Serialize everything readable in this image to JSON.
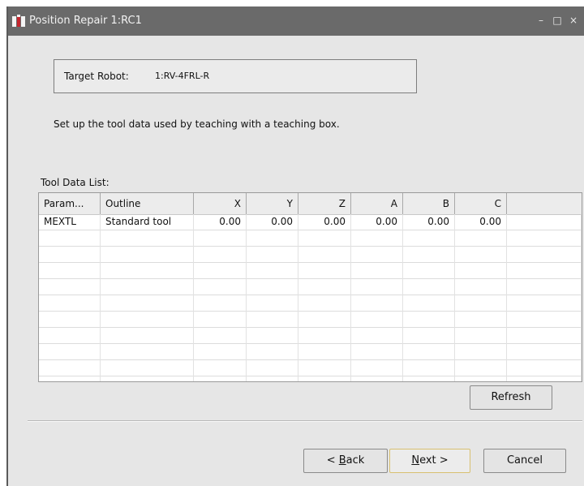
{
  "window": {
    "title": "Position Repair 1:RC1",
    "minimize": "–",
    "maximize": "□",
    "close": "×"
  },
  "target": {
    "label": "Target Robot:",
    "value": "1:RV-4FRL-R"
  },
  "description": "Set up the tool data used by teaching with a teaching box.",
  "tool_list": {
    "label": "Tool Data List:",
    "columns": [
      "Param...",
      "Outline",
      "X",
      "Y",
      "Z",
      "A",
      "B",
      "C"
    ],
    "rows": [
      [
        "MEXTL",
        "Standard tool",
        "0.00",
        "0.00",
        "0.00",
        "0.00",
        "0.00",
        "0.00"
      ]
    ]
  },
  "buttons": {
    "refresh": "Refresh",
    "back": "< Back",
    "back_mnemonic": "B",
    "next": "Next >",
    "next_mnemonic": "N",
    "cancel": "Cancel"
  },
  "colors": {
    "titlebar": "#6a6a6a",
    "dialog": "#e6e6e6",
    "next_focus": "#d8c070"
  }
}
